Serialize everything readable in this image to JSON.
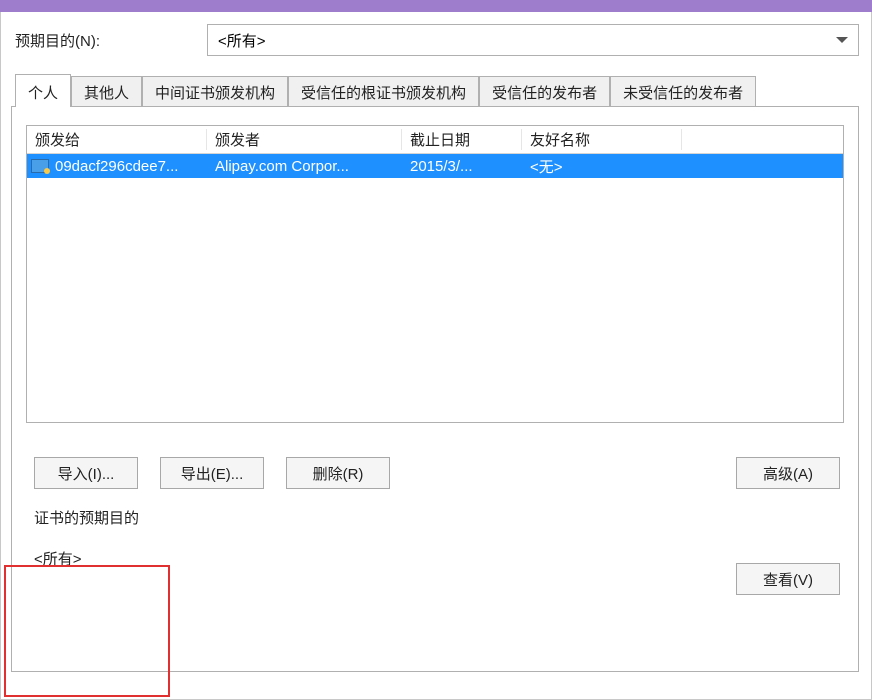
{
  "purpose": {
    "label": "预期目的(N):",
    "value": "<所有>"
  },
  "tabs": [
    {
      "label": "个人",
      "active": true
    },
    {
      "label": "其他人"
    },
    {
      "label": "中间证书颁发机构"
    },
    {
      "label": "受信任的根证书颁发机构"
    },
    {
      "label": "受信任的发布者"
    },
    {
      "label": "未受信任的发布者"
    }
  ],
  "columns": {
    "issued_to": "颁发给",
    "issued_by": "颁发者",
    "expiry": "截止日期",
    "friendly": "友好名称"
  },
  "rows": [
    {
      "issued_to": "09dacf296cdee7...",
      "issued_by": "Alipay.com Corpor...",
      "expiry": "2015/3/...",
      "friendly": "<无>",
      "selected": true
    }
  ],
  "buttons": {
    "import": "导入(I)...",
    "export": "导出(E)...",
    "delete": "删除(R)",
    "advanced": "高级(A)",
    "view": "查看(V)"
  },
  "cert_purpose": {
    "label": "证书的预期目的",
    "value": "<所有>"
  }
}
